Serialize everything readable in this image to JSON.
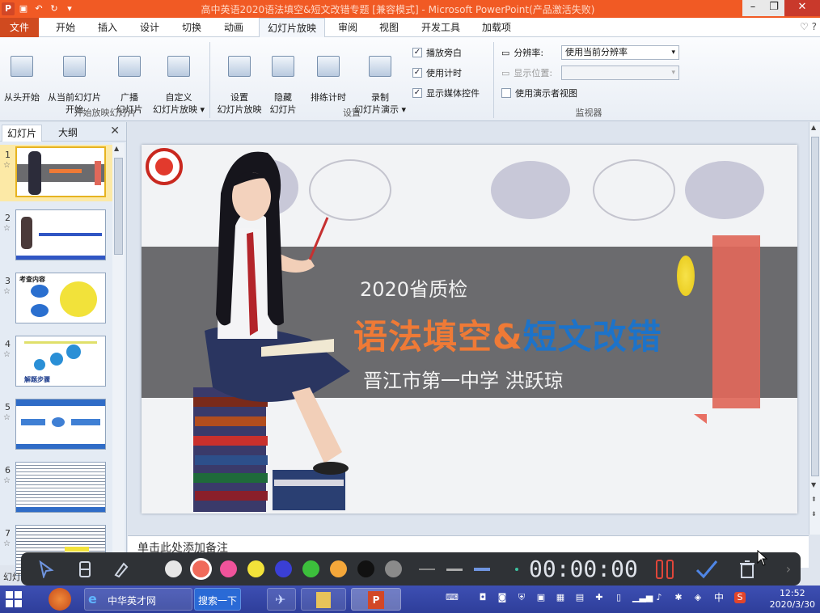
{
  "window": {
    "title": "高中英语2020语法填空&短文改错专题 [兼容模式] - Microsoft PowerPoint(产品激活失败)",
    "app_letter": "P",
    "controls": {
      "minimize": "–",
      "maximize": "❐",
      "close": "✕"
    }
  },
  "tabs": {
    "file": "文件",
    "items": [
      "开始",
      "插入",
      "设计",
      "切换",
      "动画",
      "幻灯片放映",
      "审阅",
      "视图",
      "开发工具",
      "加载项"
    ],
    "active": "幻灯片放映",
    "right_icons": "♡ ?"
  },
  "ribbon": {
    "start_group": {
      "label": "开始放映幻灯片",
      "buttons": [
        {
          "label": "从头开始"
        },
        {
          "label": "从当前幻灯片\n开始"
        },
        {
          "label": "广播\n幻灯片"
        },
        {
          "label": "自定义\n幻灯片放映 ▾"
        }
      ]
    },
    "setup_group": {
      "label": "设置",
      "buttons": [
        {
          "label": "设置\n幻灯片放映"
        },
        {
          "label": "隐藏\n幻灯片"
        },
        {
          "label": "排练计时"
        },
        {
          "label": "录制\n幻灯片演示 ▾"
        }
      ],
      "checkboxes": [
        {
          "label": "播放旁白",
          "checked": true
        },
        {
          "label": "使用计时",
          "checked": true
        },
        {
          "label": "显示媒体控件",
          "checked": true
        }
      ]
    },
    "monitor_group": {
      "label": "监视器",
      "resolution_label": "分辨率:",
      "resolution_value": "使用当前分辨率",
      "display_label": "显示位置:",
      "display_value": "",
      "presenter_view": {
        "label": "使用演示者视图",
        "checked": false
      }
    }
  },
  "left_panel": {
    "tabs": [
      "幻灯片",
      "大纲"
    ],
    "close": "✕",
    "thumbnails": [
      {
        "num": "1",
        "star": "☆",
        "selected": true
      },
      {
        "num": "2",
        "star": "☆",
        "selected": false
      },
      {
        "num": "3",
        "star": "☆",
        "selected": false,
        "caption": "考查内容"
      },
      {
        "num": "4",
        "star": "☆",
        "selected": false,
        "caption": "解题步骤"
      },
      {
        "num": "5",
        "star": "☆",
        "selected": false
      },
      {
        "num": "6",
        "star": "☆",
        "selected": false
      },
      {
        "num": "7",
        "star": "☆",
        "selected": false
      }
    ]
  },
  "slide": {
    "year_line": "2020省质检",
    "title_orange": "语法填空&",
    "title_blue": "短文改错",
    "school_line": "晋江市第一中学  洪跃琼",
    "colors": {
      "band": "#6b6b6e",
      "orange": "#ef7a36",
      "blue": "#1d73c9",
      "red_rect": "#e0685a"
    }
  },
  "notes": {
    "placeholder": "单击此处添加备注"
  },
  "status": {
    "left": "幻灯"
  },
  "pen_toolbar": {
    "colors": [
      "#e6e6e6",
      "#f06a5a",
      "#f0539b",
      "#f2e23a",
      "#3a3fd6",
      "#3cbf3c",
      "#f4a73a",
      "#111111",
      "#8a8a8a"
    ],
    "selected_color": "#f06a5a",
    "timer": "00:00:00"
  },
  "taskbar": {
    "browser_label": "中华英才网",
    "search_label": "搜索一下",
    "ime_label": "中",
    "time": "12:52",
    "date": "2020/3/30"
  }
}
